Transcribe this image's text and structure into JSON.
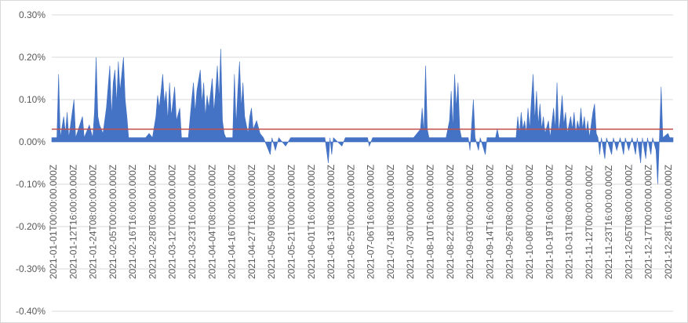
{
  "chart_data": {
    "type": "area",
    "title": "",
    "xlabel": "",
    "ylabel": "",
    "y_tick_labels": [
      "0.30%",
      "0.20%",
      "0.10%",
      "0.00%",
      "-0.10%",
      "-0.20%",
      "-0.30%",
      "-0.40%"
    ],
    "ylim": [
      -0.4,
      0.3
    ],
    "y_unit": "%",
    "x_tick_labels": [
      "2021-01-01T00:00:00.000Z",
      "2021-01-12T16:00:00.000Z",
      "2021-01-24T08:00:00.000Z",
      "2021-02-05T00:00:00.000Z",
      "2021-02-16T16:00:00.000Z",
      "2021-02-28T08:00:00.000Z",
      "2021-03-12T00:00:00.000Z",
      "2021-03-23T16:00:00.000Z",
      "2021-04-04T08:00:00.000Z",
      "2021-04-16T00:00:00.000Z",
      "2021-04-27T16:00:00.000Z",
      "2021-05-09T08:00:00.000Z",
      "2021-05-21T00:00:00.000Z",
      "2021-06-01T16:00:00.000Z",
      "2021-06-13T08:00:00.000Z",
      "2021-06-25T00:00:00.000Z",
      "2021-07-06T16:00:00.000Z",
      "2021-07-18T08:00:00.000Z",
      "2021-07-30T00:00:00.000Z",
      "2021-08-10T16:00:00.000Z",
      "2021-08-22T08:00:00.000Z",
      "2021-09-03T00:00:00.000Z",
      "2021-09-14T16:00:00.000Z",
      "2021-09-26T08:00:00.000Z",
      "2021-10-08T00:00:00.000Z",
      "2021-10-19T16:00:00.000Z",
      "2021-10-31T08:00:00.000Z",
      "2021-11-12T00:00:00.000Z",
      "2021-11-23T16:00:00.000Z",
      "2021-12-05T08:00:00.000Z",
      "2021-12-17T00:00:00.000Z",
      "2021-12-28T16:00:00.000Z"
    ],
    "grid": true,
    "legend": "none",
    "series": [
      {
        "kind": "area",
        "color": "#4472C4",
        "points": [
          [
            "2021-01-01",
            0.01
          ],
          [
            "2021-01-04",
            0.01
          ],
          [
            "2021-01-05",
            0.16
          ],
          [
            "2021-01-06",
            0.01
          ],
          [
            "2021-01-08",
            0.06
          ],
          [
            "2021-01-09",
            0.02
          ],
          [
            "2021-01-10",
            0.07
          ],
          [
            "2021-01-11",
            0.01
          ],
          [
            "2021-01-14",
            0.1
          ],
          [
            "2021-01-15",
            0.01
          ],
          [
            "2021-01-19",
            0.06
          ],
          [
            "2021-01-20",
            0.01
          ],
          [
            "2021-01-23",
            0.04
          ],
          [
            "2021-01-25",
            0.01
          ],
          [
            "2021-01-26",
            0.07
          ],
          [
            "2021-01-27",
            0.2
          ],
          [
            "2021-01-28",
            0.06
          ],
          [
            "2021-01-29",
            0.04
          ],
          [
            "2021-01-31",
            0.02
          ],
          [
            "2021-02-02",
            0.08
          ],
          [
            "2021-02-04",
            0.18
          ],
          [
            "2021-02-05",
            0.06
          ],
          [
            "2021-02-06",
            0.14
          ],
          [
            "2021-02-07",
            0.17
          ],
          [
            "2021-02-08",
            0.09
          ],
          [
            "2021-02-09",
            0.19
          ],
          [
            "2021-02-10",
            0.12
          ],
          [
            "2021-02-11",
            0.16
          ],
          [
            "2021-02-12",
            0.2
          ],
          [
            "2021-02-13",
            0.1
          ],
          [
            "2021-02-14",
            0.06
          ],
          [
            "2021-02-15",
            0.01
          ],
          [
            "2021-02-25",
            0.01
          ],
          [
            "2021-02-27",
            0.02
          ],
          [
            "2021-03-01",
            0.01
          ],
          [
            "2021-03-03",
            0.06
          ],
          [
            "2021-03-04",
            0.11
          ],
          [
            "2021-03-05",
            0.08
          ],
          [
            "2021-03-07",
            0.16
          ],
          [
            "2021-03-08",
            0.09
          ],
          [
            "2021-03-09",
            0.12
          ],
          [
            "2021-03-10",
            0.05
          ],
          [
            "2021-03-11",
            0.14
          ],
          [
            "2021-03-12",
            0.06
          ],
          [
            "2021-03-14",
            0.13
          ],
          [
            "2021-03-15",
            0.05
          ],
          [
            "2021-03-17",
            0.08
          ],
          [
            "2021-03-18",
            0.01
          ],
          [
            "2021-03-22",
            0.01
          ],
          [
            "2021-03-24",
            0.1
          ],
          [
            "2021-03-25",
            0.14
          ],
          [
            "2021-03-26",
            0.07
          ],
          [
            "2021-03-27",
            0.12
          ],
          [
            "2021-03-29",
            0.17
          ],
          [
            "2021-03-30",
            0.09
          ],
          [
            "2021-03-31",
            0.14
          ],
          [
            "2021-04-01",
            0.06
          ],
          [
            "2021-04-02",
            0.11
          ],
          [
            "2021-04-03",
            0.08
          ],
          [
            "2021-04-05",
            0.15
          ],
          [
            "2021-04-06",
            0.07
          ],
          [
            "2021-04-07",
            0.12
          ],
          [
            "2021-04-08",
            0.18
          ],
          [
            "2021-04-09",
            0.1
          ],
          [
            "2021-04-10",
            0.22
          ],
          [
            "2021-04-11",
            0.05
          ],
          [
            "2021-04-12",
            0.02
          ],
          [
            "2021-04-13",
            0.01
          ],
          [
            "2021-04-17",
            0.01
          ],
          [
            "2021-04-18",
            0.16
          ],
          [
            "2021-04-19",
            0.04
          ],
          [
            "2021-04-20",
            0.12
          ],
          [
            "2021-04-21",
            0.19
          ],
          [
            "2021-04-22",
            0.08
          ],
          [
            "2021-04-23",
            0.14
          ],
          [
            "2021-04-24",
            0.06
          ],
          [
            "2021-04-26",
            0.02
          ],
          [
            "2021-04-27",
            0.06
          ],
          [
            "2021-04-28",
            0.08
          ],
          [
            "2021-04-29",
            0.03
          ],
          [
            "2021-05-01",
            0.05
          ],
          [
            "2021-05-03",
            0.02
          ],
          [
            "2021-05-05",
            0.01
          ],
          [
            "2021-05-07",
            -0.01
          ],
          [
            "2021-05-09",
            -0.03
          ],
          [
            "2021-05-10",
            0.01
          ],
          [
            "2021-05-12",
            -0.02
          ],
          [
            "2021-05-14",
            0.01
          ],
          [
            "2021-05-18",
            -0.01
          ],
          [
            "2021-05-21",
            0.01
          ],
          [
            "2021-06-01",
            0.01
          ],
          [
            "2021-06-10",
            0.01
          ],
          [
            "2021-06-12",
            -0.05
          ],
          [
            "2021-06-13",
            0.01
          ],
          [
            "2021-06-14",
            -0.03
          ],
          [
            "2021-06-15",
            0.01
          ],
          [
            "2021-06-20",
            -0.01
          ],
          [
            "2021-06-22",
            0.01
          ],
          [
            "2021-07-05",
            0.01
          ],
          [
            "2021-07-06",
            -0.01
          ],
          [
            "2021-07-08",
            0.01
          ],
          [
            "2021-07-20",
            0.01
          ],
          [
            "2021-08-01",
            0.01
          ],
          [
            "2021-08-05",
            0.03
          ],
          [
            "2021-08-06",
            0.08
          ],
          [
            "2021-08-07",
            0.02
          ],
          [
            "2021-08-08",
            0.18
          ],
          [
            "2021-08-09",
            0.03
          ],
          [
            "2021-08-10",
            0.01
          ],
          [
            "2021-08-20",
            0.01
          ],
          [
            "2021-08-22",
            0.05
          ],
          [
            "2021-08-23",
            0.12
          ],
          [
            "2021-08-24",
            0.03
          ],
          [
            "2021-08-25",
            0.16
          ],
          [
            "2021-08-26",
            0.08
          ],
          [
            "2021-08-27",
            0.14
          ],
          [
            "2021-08-28",
            0.03
          ],
          [
            "2021-08-29",
            0.01
          ],
          [
            "2021-09-02",
            0.01
          ],
          [
            "2021-09-03",
            -0.02
          ],
          [
            "2021-09-05",
            0.1
          ],
          [
            "2021-09-06",
            0.01
          ],
          [
            "2021-09-08",
            -0.02
          ],
          [
            "2021-09-09",
            0.01
          ],
          [
            "2021-09-12",
            -0.03
          ],
          [
            "2021-09-13",
            0.01
          ],
          [
            "2021-09-18",
            0.01
          ],
          [
            "2021-09-19",
            0.03
          ],
          [
            "2021-09-20",
            0.01
          ],
          [
            "2021-09-30",
            0.01
          ],
          [
            "2021-10-01",
            0.06
          ],
          [
            "2021-10-02",
            0.02
          ],
          [
            "2021-10-03",
            0.07
          ],
          [
            "2021-10-04",
            0.03
          ],
          [
            "2021-10-05",
            0.05
          ],
          [
            "2021-10-06",
            0.02
          ],
          [
            "2021-10-07",
            0.08
          ],
          [
            "2021-10-08",
            0.03
          ],
          [
            "2021-10-09",
            0.1
          ],
          [
            "2021-10-10",
            0.16
          ],
          [
            "2021-10-11",
            0.05
          ],
          [
            "2021-10-12",
            0.12
          ],
          [
            "2021-10-13",
            0.04
          ],
          [
            "2021-10-14",
            0.09
          ],
          [
            "2021-10-15",
            0.03
          ],
          [
            "2021-10-16",
            0.06
          ],
          [
            "2021-10-17",
            0.02
          ],
          [
            "2021-10-19",
            0.05
          ],
          [
            "2021-10-20",
            0.01
          ],
          [
            "2021-10-22",
            0.08
          ],
          [
            "2021-10-23",
            0.03
          ],
          [
            "2021-10-24",
            0.14
          ],
          [
            "2021-10-25",
            0.02
          ],
          [
            "2021-10-26",
            0.06
          ],
          [
            "2021-10-27",
            0.11
          ],
          [
            "2021-10-28",
            0.04
          ],
          [
            "2021-10-29",
            0.07
          ],
          [
            "2021-10-30",
            0.02
          ],
          [
            "2021-11-01",
            0.06
          ],
          [
            "2021-11-02",
            0.03
          ],
          [
            "2021-11-03",
            0.07
          ],
          [
            "2021-11-04",
            0.02
          ],
          [
            "2021-11-05",
            0.05
          ],
          [
            "2021-11-06",
            0.03
          ],
          [
            "2021-11-07",
            0.08
          ],
          [
            "2021-11-08",
            0.03
          ],
          [
            "2021-11-09",
            0.06
          ],
          [
            "2021-11-10",
            0.02
          ],
          [
            "2021-11-11",
            0.05
          ],
          [
            "2021-11-12",
            0.01
          ],
          [
            "2021-11-14",
            0.07
          ],
          [
            "2021-11-15",
            0.09
          ],
          [
            "2021-11-16",
            0.02
          ],
          [
            "2021-11-17",
            0.01
          ],
          [
            "2021-11-18",
            -0.03
          ],
          [
            "2021-11-19",
            0.01
          ],
          [
            "2021-11-21",
            -0.04
          ],
          [
            "2021-11-22",
            0.01
          ],
          [
            "2021-11-25",
            -0.03
          ],
          [
            "2021-11-26",
            0.01
          ],
          [
            "2021-11-28",
            -0.02
          ],
          [
            "2021-11-30",
            0.01
          ],
          [
            "2021-12-02",
            -0.03
          ],
          [
            "2021-12-03",
            0.01
          ],
          [
            "2021-12-05",
            -0.02
          ],
          [
            "2021-12-07",
            0.01
          ],
          [
            "2021-12-09",
            -0.03
          ],
          [
            "2021-12-10",
            0.01
          ],
          [
            "2021-12-12",
            -0.05
          ],
          [
            "2021-12-13",
            0.01
          ],
          [
            "2021-12-15",
            -0.04
          ],
          [
            "2021-12-16",
            0.01
          ],
          [
            "2021-12-18",
            -0.03
          ],
          [
            "2021-12-19",
            0.01
          ],
          [
            "2021-12-21",
            -0.02
          ],
          [
            "2021-12-22",
            -0.1
          ],
          [
            "2021-12-23",
            0.01
          ],
          [
            "2021-12-24",
            0.13
          ],
          [
            "2021-12-25",
            0.01
          ],
          [
            "2021-12-28",
            0.02
          ],
          [
            "2021-12-29",
            0.01
          ],
          [
            "2021-12-31",
            0.01
          ]
        ]
      },
      {
        "kind": "line",
        "color": "#C0504D",
        "points": [
          [
            "2021-01-01",
            0.03
          ],
          [
            "2021-12-31",
            0.03
          ]
        ]
      }
    ]
  }
}
